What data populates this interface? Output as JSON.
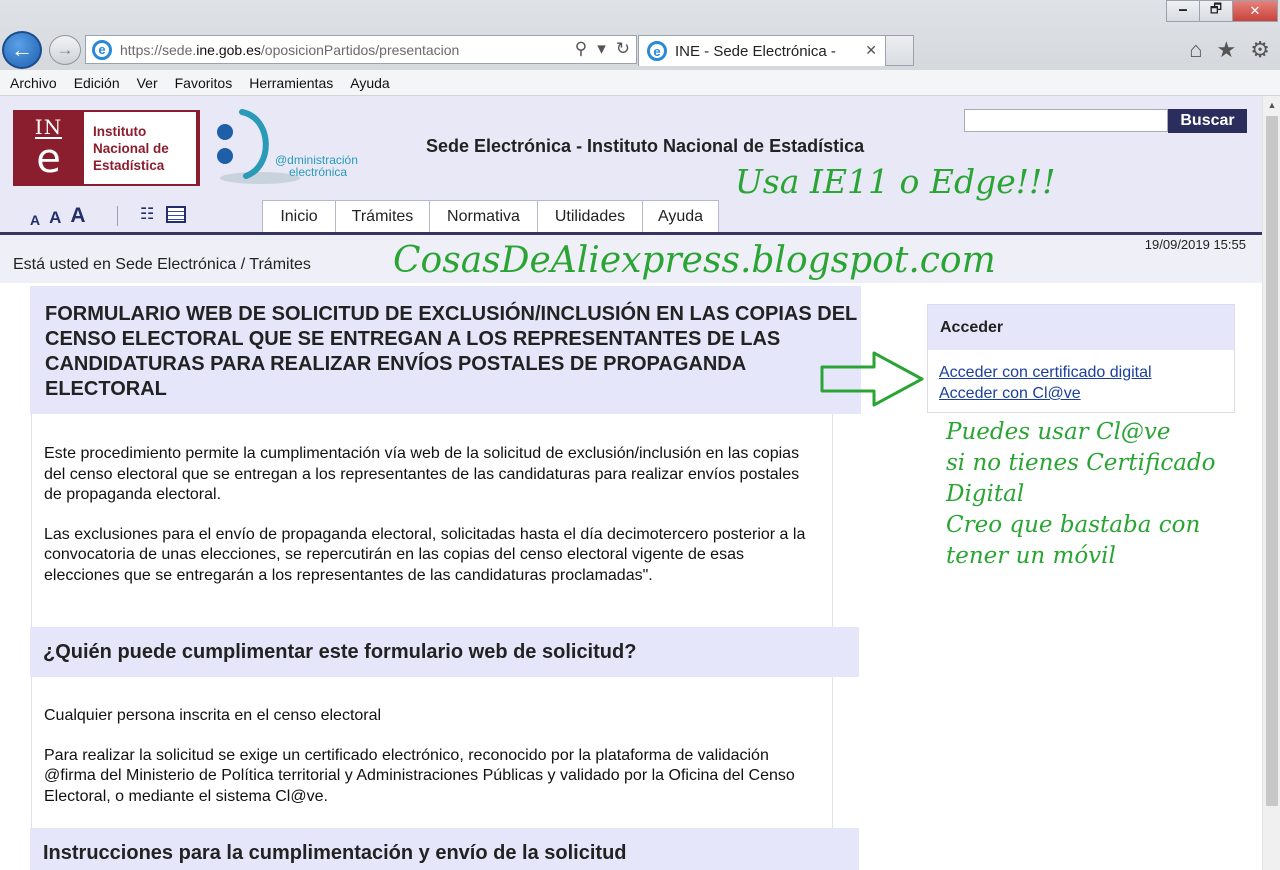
{
  "browser": {
    "window_controls": [
      "🗕",
      "🗗",
      "✕"
    ],
    "address": {
      "prefix": "https://sede.",
      "host": "ine.gob.es",
      "suffix": "/oposicionPartidos/presentacion"
    },
    "tab": {
      "title": "INE - Sede Electrónica -",
      "close": "✕"
    },
    "menu": [
      "Archivo",
      "Edición",
      "Ver",
      "Favoritos",
      "Herramientas",
      "Ayuda"
    ]
  },
  "header": {
    "logo_mark_top": "IN",
    "logo_mark_bottom": "e",
    "logo_name": [
      "Instituto",
      "Nacional de",
      "Estadística"
    ],
    "admin_text": [
      "@dministración",
      "electrónica"
    ],
    "site_title": "Sede Electrónica - Instituto Nacional de Estadística",
    "search_button": "Buscar",
    "font_sizes": [
      "A",
      "A",
      "A"
    ],
    "nav": [
      "Inicio",
      "Trámites",
      "Normativa",
      "Utilidades",
      "Ayuda"
    ]
  },
  "breadcrumb": "Está usted en Sede Electrónica / Trámites",
  "datetime": "19/09/2019 15:55",
  "main": {
    "title": "FORMULARIO WEB DE SOLICITUD DE EXCLUSIÓN/INCLUSIÓN EN LAS COPIAS DEL CENSO ELECTORAL QUE SE ENTREGAN A LOS REPRESENTANTES DE LAS CANDIDATURAS PARA REALIZAR ENVÍOS POSTALES DE PROPAGANDA ELECTORAL",
    "intro_p1": "Este procedimiento permite la cumplimentación vía web de la solicitud de exclusión/inclusión en las copias del censo electoral que se entregan a los representantes de las candidaturas para realizar envíos postales de propaganda electoral.",
    "intro_p2": "Las exclusiones para el envío de propaganda electoral, solicitadas hasta el día decimotercero posterior a la convocatoria de unas elecciones, se repercutirán en las copias del censo electoral vigente de esas elecciones que se entregarán a los representantes de las candidaturas proclamadas\".",
    "section1_title": "¿Quién puede cumplimentar este formulario web de solicitud?",
    "section1_p1": "Cualquier persona inscrita en el censo electoral",
    "section1_p2": "Para realizar la solicitud se exige un certificado electrónico, reconocido por la plataforma de validación @firma del Ministerio de Política territorial y Administraciones Públicas y validado por la Oficina del Censo Electoral, o mediante el sistema Cl@ve.",
    "section2_title": "Instrucciones para la cumplimentación y envío de la solicitud"
  },
  "access": {
    "title": "Acceder",
    "cert_link": "Acceder con certificado digital",
    "clave_link": "Acceder con Cl@ve"
  },
  "annotations": {
    "browser_note": "Usa IE11 o Edge!!!",
    "blog": "CosasDeAliexpress.blogspot.com",
    "clave_note": [
      "Puedes usar Cl@ve",
      "si no tienes Certificado",
      "Digital",
      "Creo que bastaba con",
      "tener un móvil"
    ],
    "color": "#2aa534"
  },
  "colors": {
    "header_bg": "#e8e8f7",
    "accent": "#2b2d5c",
    "ine_red": "#8b1e2e",
    "link": "#1a3f9c"
  }
}
